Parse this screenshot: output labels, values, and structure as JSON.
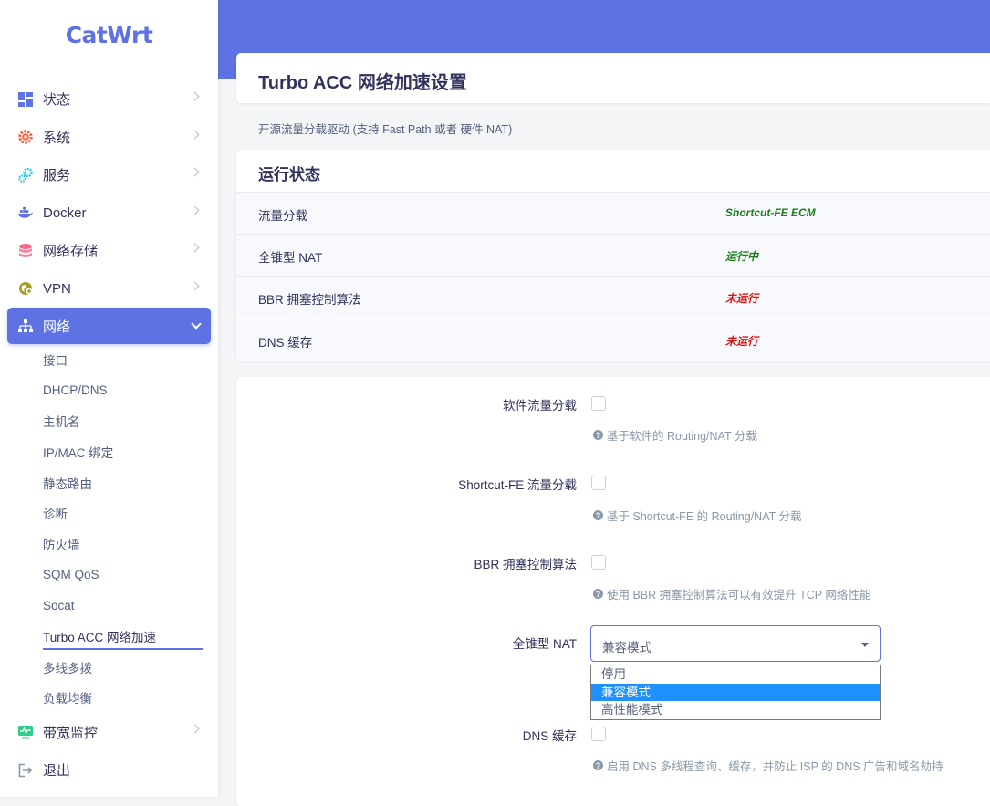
{
  "brand": "CatWrt",
  "menu": [
    {
      "label": "状态",
      "icon": "dashboard-icon"
    },
    {
      "label": "系统",
      "icon": "gear-icon"
    },
    {
      "label": "服务",
      "icon": "cogs-icon"
    },
    {
      "label": "Docker",
      "icon": "docker-icon"
    },
    {
      "label": "网络存储",
      "icon": "database-icon"
    },
    {
      "label": "VPN",
      "icon": "globe-icon"
    },
    {
      "label": "网络",
      "icon": "sitemap-icon"
    }
  ],
  "submenu": [
    "接口",
    "DHCP/DNS",
    "主机名",
    "IP/MAC 绑定",
    "静态路由",
    "诊断",
    "防火墙",
    "SQM QoS",
    "Socat",
    "Turbo ACC 网络加速",
    "多线多拨",
    "负载均衡"
  ],
  "menu_bottom": [
    {
      "label": "带宽监控",
      "icon": "monitor-icon"
    },
    {
      "label": "退出",
      "icon": "logout-icon"
    }
  ],
  "page": {
    "title": "Turbo ACC 网络加速设置",
    "description": "开源流量分载驱动 (支持 Fast Path 或者 硬件 NAT)"
  },
  "status": {
    "title": "运行状态",
    "rows": [
      {
        "label": "流量分载",
        "value": "Shortcut-FE ECM",
        "color": "#1f7d1f"
      },
      {
        "label": "全锥型 NAT",
        "value": "运行中",
        "color": "#1f7d1f"
      },
      {
        "label": "BBR 拥塞控制算法",
        "value": "未运行",
        "color": "#e01010"
      },
      {
        "label": "DNS 缓存",
        "value": "未运行",
        "color": "#e01010"
      }
    ]
  },
  "form": {
    "sw_offload": {
      "label": "软件流量分载",
      "help": "基于软件的 Routing/NAT 分载",
      "checked": false
    },
    "sfe": {
      "label": "Shortcut-FE 流量分载",
      "help": "基于 Shortcut-FE 的 Routing/NAT 分载",
      "checked": false
    },
    "bbr": {
      "label": "BBR 拥塞控制算法",
      "help": "使用 BBR 拥塞控制算法可以有效提升 TCP 网络性能",
      "checked": false
    },
    "fullcone": {
      "label": "全锥型 NAT",
      "selected": "兼容模式",
      "options": [
        "停用",
        "兼容模式",
        "高性能模式"
      ]
    },
    "dns": {
      "label": "DNS 缓存",
      "help": "启用 DNS 多线程查询、缓存，并防止 ISP 的 DNS 广告和域名劫持",
      "checked": false
    }
  },
  "colors": {
    "accent": "#5e72e4",
    "ok": "#1f7d1f",
    "error": "#e01010",
    "option_highlight": "#1e90ff"
  }
}
